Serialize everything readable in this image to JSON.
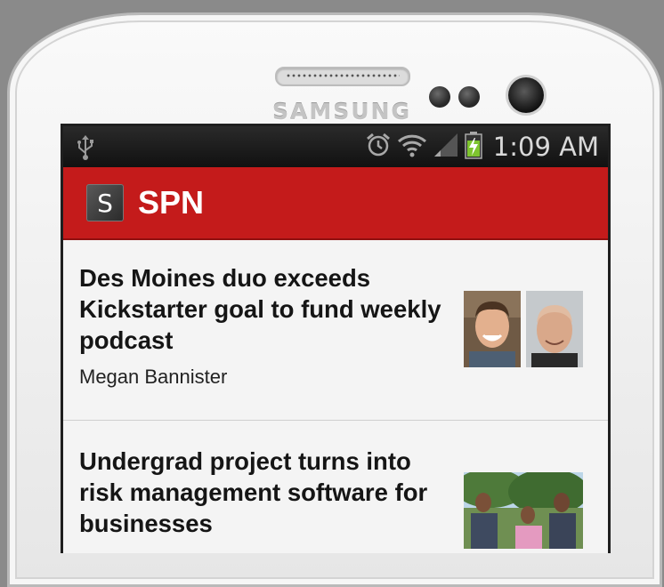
{
  "device": {
    "brand": "SAMSUNG"
  },
  "status_bar": {
    "time": "1:09 AM"
  },
  "app": {
    "logo_letter": "S",
    "title": "SPN"
  },
  "articles": [
    {
      "title": "Des Moines duo exceeds Kickstarter goal to fund weekly podcast",
      "author": "Megan Bannister"
    },
    {
      "title": "Undergrad project turns into risk management software for businesses",
      "author": ""
    }
  ],
  "icons": [
    "usb-icon",
    "alarm-icon",
    "wifi-icon",
    "signal-icon",
    "battery-charging-icon"
  ],
  "colors": {
    "action_bar": "#c41b1b",
    "status_bar": "#1b1b1b",
    "battery": "#7ec52e"
  }
}
